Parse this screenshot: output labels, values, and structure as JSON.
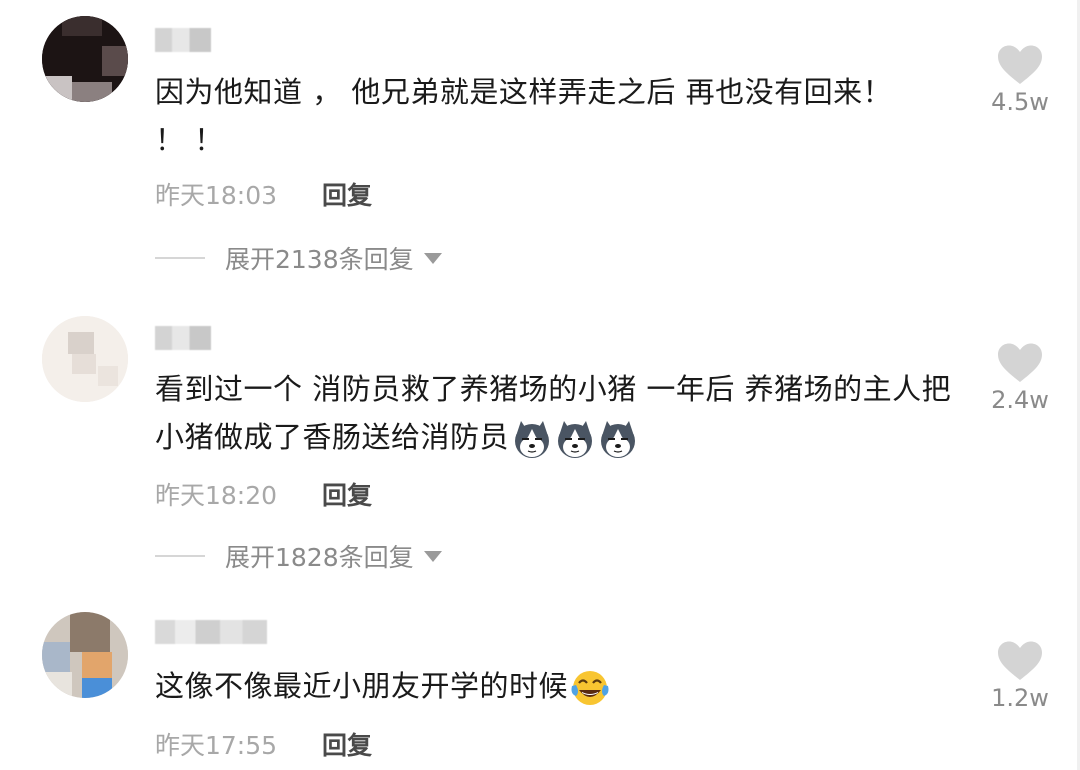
{
  "comments": [
    {
      "text": "因为他知道 ， 他兄弟就是这样弄走之后 再也没有回来！ ！ ！",
      "time": "昨天18:03",
      "reply_label": "回复",
      "expand_label": "展开2138条回复",
      "likes": "4.5w"
    },
    {
      "text": "看到过一个 消防员救了养猪场的小猪 一年后 养猪场的主人把小猪做成了香肠送给消防员",
      "time": "昨天18:20",
      "reply_label": "回复",
      "expand_label": "展开1828条回复",
      "likes": "2.4w",
      "emojis": [
        "husky-icon",
        "husky-icon",
        "husky-icon"
      ]
    },
    {
      "text": "这像不像最近小朋友开学的时候",
      "time": "昨天17:55",
      "reply_label": "回复",
      "likes": "1.2w",
      "emojis": [
        "tears-of-joy-icon"
      ]
    }
  ],
  "colors": {
    "text": "#1a1a1a",
    "meta": "#a8a8a8",
    "heart": "#d4d4d4"
  }
}
